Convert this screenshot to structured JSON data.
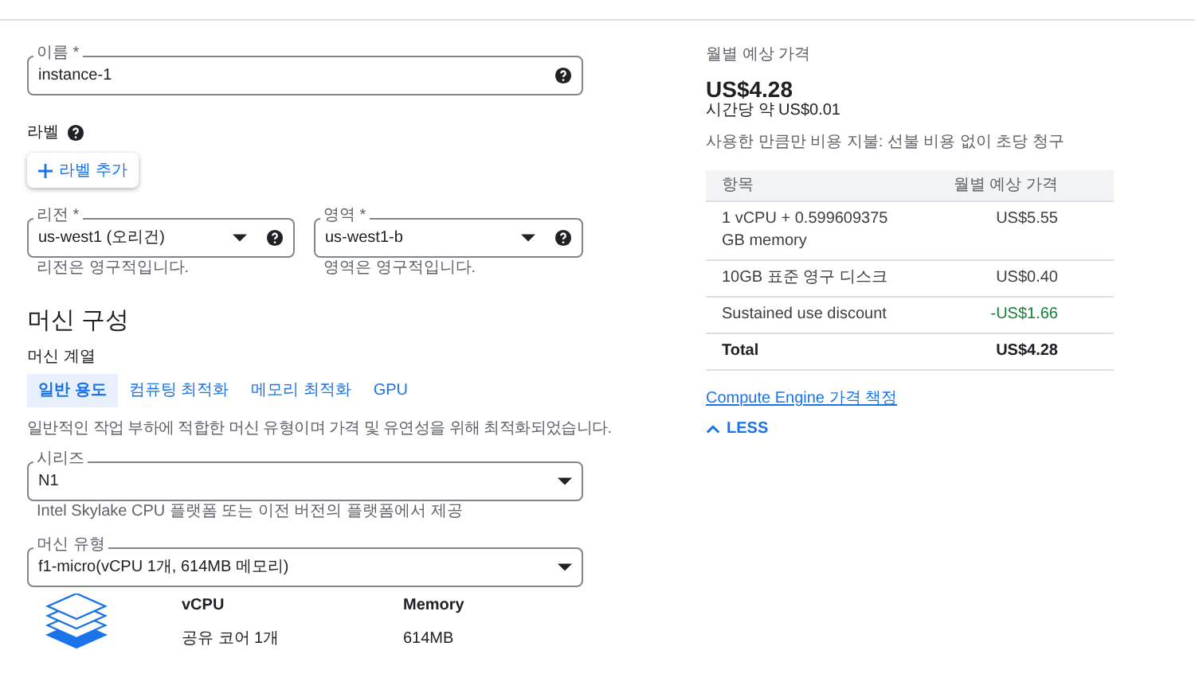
{
  "name_field": {
    "label": "이름 *",
    "value": "instance-1"
  },
  "labels": {
    "title": "라벨",
    "add_button": "라벨 추가"
  },
  "region": {
    "label": "리전 *",
    "value": "us-west1 (오리건)",
    "hint": "리전은 영구적입니다."
  },
  "zone": {
    "label": "영역 *",
    "value": "us-west1-b",
    "hint": "영역은 영구적입니다."
  },
  "machine_config": {
    "title": "머신 구성",
    "family_label": "머신 계열",
    "tabs": [
      {
        "label": "일반 용도",
        "selected": true
      },
      {
        "label": "컴퓨팅 최적화",
        "selected": false
      },
      {
        "label": "메모리 최적화",
        "selected": false
      },
      {
        "label": "GPU",
        "selected": false
      }
    ],
    "description": "일반적인 작업 부하에 적합한 머신 유형이며 가격 및 유연성을 위해 최적화되었습니다.",
    "series": {
      "label": "시리즈",
      "value": "N1",
      "hint": "Intel Skylake CPU 플랫폼 또는 이전 버전의 플랫폼에서 제공"
    },
    "machine_type": {
      "label": "머신 유형",
      "value": "f1-micro(vCPU 1개, 614MB 메모리)"
    },
    "specs": [
      {
        "heading": "vCPU",
        "value": "공유 코어 1개"
      },
      {
        "heading": "Memory",
        "value": "614MB"
      }
    ]
  },
  "pricing": {
    "title": "월별 예상 가격",
    "total": "US$4.28",
    "hourly": "시간당 약 US$0.01",
    "note": "사용한 만큼만 비용 지불: 선불 비용 없이 초당 청구",
    "columns": [
      "항목",
      "월별 예상 가격"
    ],
    "rows": [
      {
        "kind": "normal",
        "item": "1 vCPU + 0.599609375 GB memory",
        "price": "US$5.55"
      },
      {
        "kind": "normal",
        "item": "10GB 표준 영구 디스크",
        "price": "US$0.40"
      },
      {
        "kind": "discount",
        "item": "Sustained use discount",
        "price": "-US$1.66"
      },
      {
        "kind": "total",
        "item": "Total",
        "price": "US$4.28"
      }
    ],
    "link": "Compute Engine 가격 책정",
    "less": "LESS"
  }
}
